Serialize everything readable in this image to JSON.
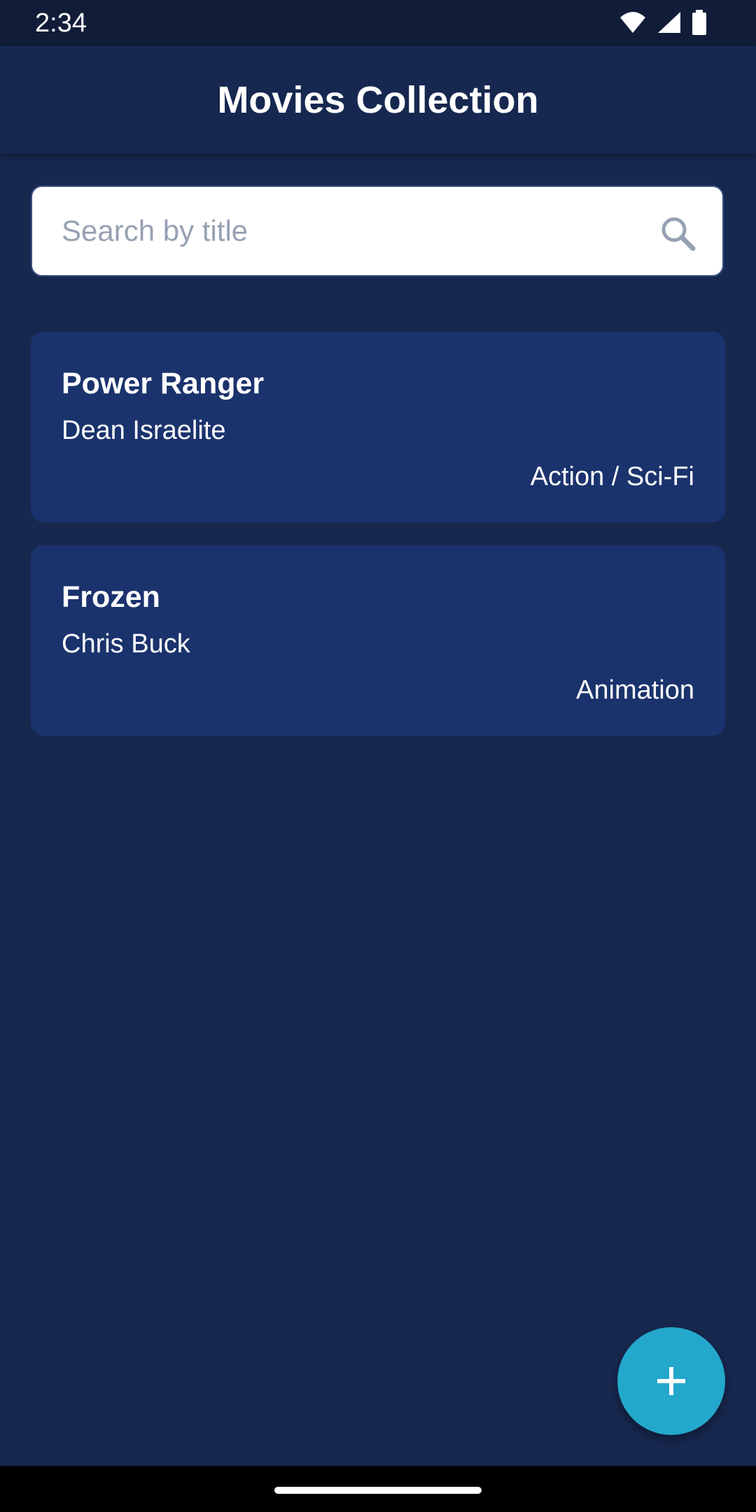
{
  "status_bar": {
    "time": "2:34",
    "icons": [
      "wifi-icon",
      "signal-icon",
      "battery-icon"
    ]
  },
  "app_bar": {
    "title": "Movies Collection"
  },
  "search": {
    "placeholder": "Search by title",
    "value": "",
    "icon": "search-icon"
  },
  "movies": [
    {
      "title": "Power Ranger",
      "director": "Dean Israelite",
      "genre": "Action / Sci-Fi"
    },
    {
      "title": "Frozen",
      "director": "Chris Buck",
      "genre": "Animation"
    }
  ],
  "fab": {
    "icon": "plus-icon"
  },
  "colors": {
    "background": "#17284f",
    "app_bar": "#162850",
    "card": "#1b336d",
    "accent": "#23a8cc",
    "placeholder": "#97a1b3"
  }
}
